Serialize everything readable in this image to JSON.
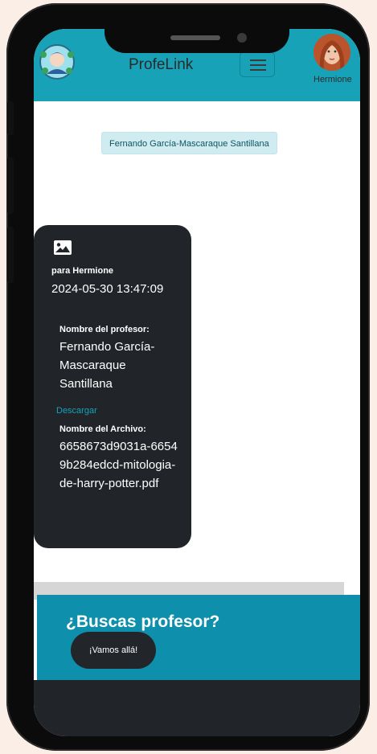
{
  "navbar": {
    "brand": "ProfeLink",
    "user_name": "Hermione",
    "accent_color": "#17a2b8"
  },
  "chat": {
    "teacher_name_pill": "Fernando García-Mascaraque Santillana"
  },
  "message_card": {
    "icon": "image-icon",
    "recipient": "para Hermione",
    "timestamp": "2024-05-30 13:47:09",
    "teacher_label": "Nombre del profesor:",
    "teacher_value": "Fernando García-Mascaraque Santillana",
    "download_label": "Descargar",
    "file_label": "Nombre del Archivo:",
    "file_value": "6658673d9031a-66549b284edcd-mitologia-de-harry-potter.pdf"
  },
  "cta": {
    "title": "¿Buscas profesor?",
    "button_label": "¡Vamos allá!"
  }
}
